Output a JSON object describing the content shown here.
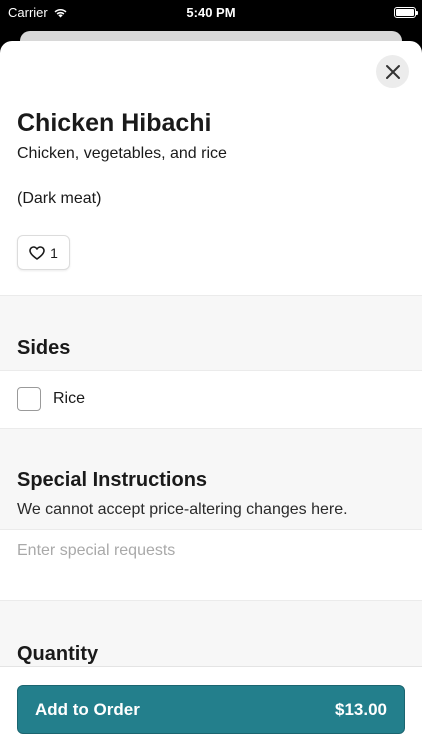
{
  "status_bar": {
    "carrier": "Carrier",
    "time": "5:40 PM",
    "battery_level": 1.0
  },
  "item": {
    "title": "Chicken Hibachi",
    "description": "Chicken, vegetables, and rice",
    "note": "(Dark meat)",
    "likes": "1"
  },
  "sides": {
    "title": "Sides",
    "options": [
      {
        "label": "Rice",
        "checked": false
      }
    ]
  },
  "special_instructions": {
    "title": "Special Instructions",
    "subtitle": "We cannot accept price-altering changes here.",
    "placeholder": "Enter special requests",
    "value": ""
  },
  "quantity": {
    "title": "Quantity"
  },
  "footer": {
    "add_label": "Add to Order",
    "price": "$13.00"
  },
  "colors": {
    "accent": "#237f8c"
  },
  "icons": {
    "close": "close-icon",
    "heart": "heart-icon",
    "wifi": "wifi-icon",
    "battery": "battery-icon"
  }
}
